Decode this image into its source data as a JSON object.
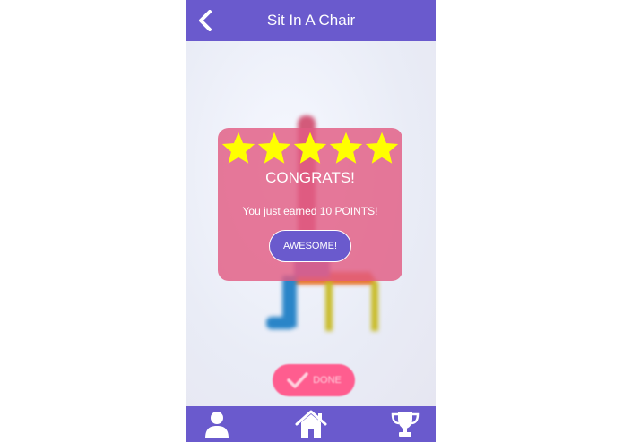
{
  "header": {
    "title": "Sit In A Chair",
    "back_icon": "chevron-left-icon"
  },
  "modal": {
    "stars_shown": 5,
    "stars_total": 5,
    "title": "CONGRATS!",
    "message": "You just earned 10 POINTS!",
    "button_label": "AWESOME!"
  },
  "done_button": {
    "label": "DONE",
    "icon": "checkmark-icon"
  },
  "bottom_nav": {
    "items": [
      {
        "icon": "profile-icon"
      },
      {
        "icon": "home-icon"
      },
      {
        "icon": "trophy-icon"
      }
    ]
  },
  "colors": {
    "header": "#6a5acd",
    "modal": "#e25b82",
    "star": "#ffff00",
    "done_button": "#ff5d8f"
  }
}
